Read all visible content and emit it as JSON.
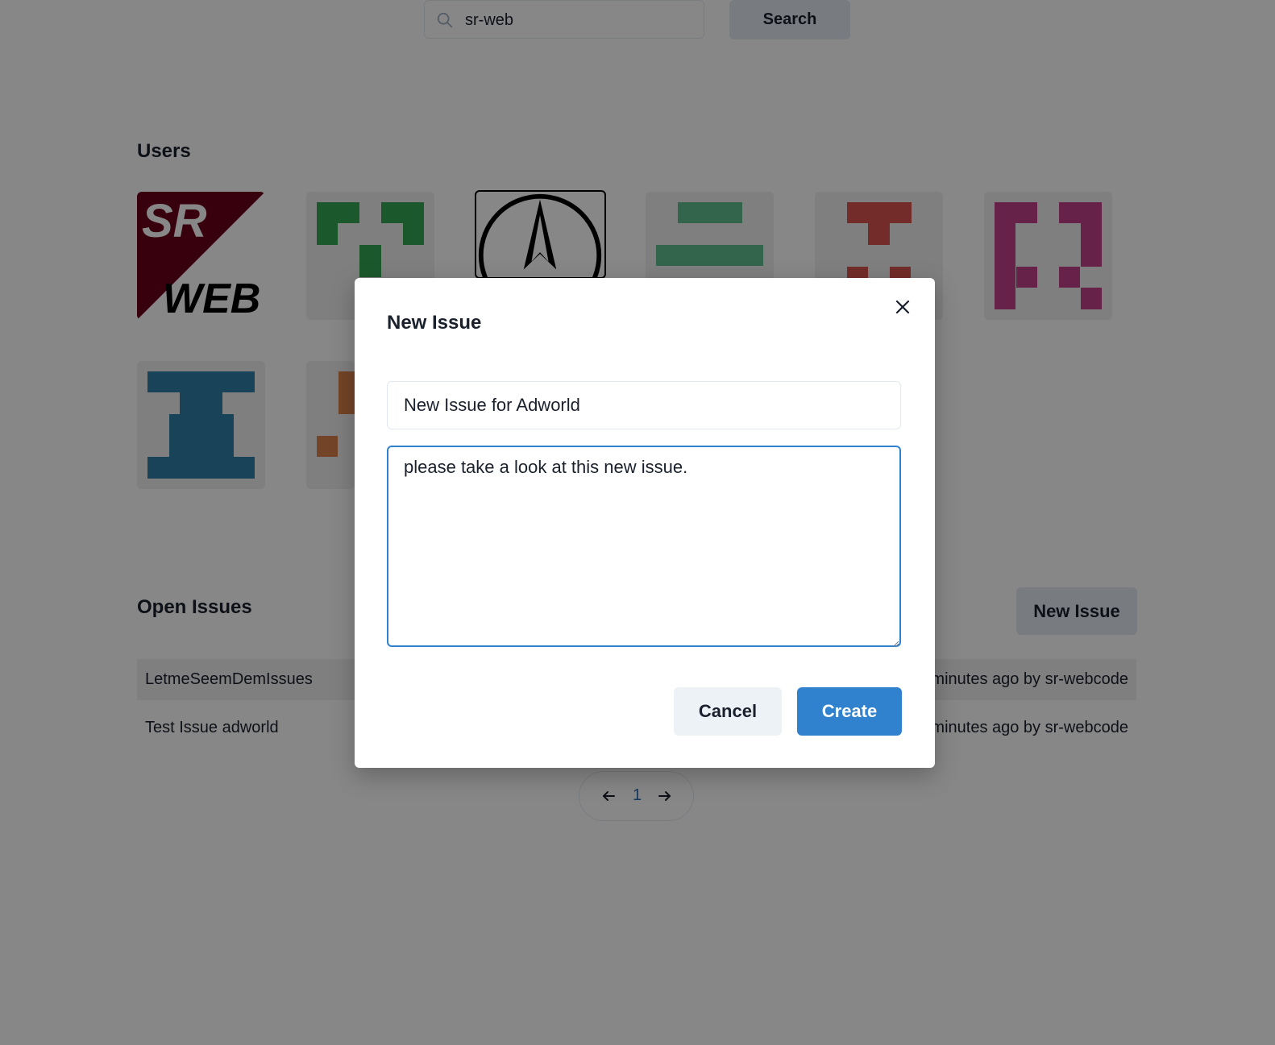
{
  "search": {
    "value": "sr-web",
    "icon": "search-icon",
    "button_label": "Search"
  },
  "users": {
    "title": "Users",
    "avatars": [
      {
        "name": "sr-web-logo",
        "text_top": "SR",
        "text_bottom": "WEB",
        "colors": [
          "#6b0019",
          "#ffffff"
        ]
      },
      {
        "name": "identicon-green",
        "color": "#34a853"
      },
      {
        "name": "circle-a-logo",
        "color": "#000000"
      },
      {
        "name": "identicon-teal",
        "color": "#5fbf8f"
      },
      {
        "name": "identicon-red",
        "color": "#d9534f"
      },
      {
        "name": "identicon-magenta",
        "color": "#c2418a"
      },
      {
        "name": "identicon-blue",
        "color": "#2f7fa6"
      },
      {
        "name": "identicon-orange",
        "color": "#d9804a"
      }
    ]
  },
  "issues": {
    "title": "Open Issues",
    "new_button_label": "New Issue",
    "rows": [
      {
        "title": "LetmeSeemDemIssues",
        "meta": "minutes ago by sr-webcode"
      },
      {
        "title": "Test Issue adworld",
        "meta": "minutes ago by sr-webcode"
      }
    ]
  },
  "pagination": {
    "current_page": "1",
    "prev_icon": "arrow-left-icon",
    "next_icon": "arrow-right-icon"
  },
  "modal": {
    "title": "New Issue",
    "close_icon": "close-icon",
    "title_value": "New Issue for Adworld",
    "body_value": "please take a look at this new issue.",
    "cancel_label": "Cancel",
    "create_label": "Create"
  },
  "colors": {
    "accent": "#3182ce",
    "overlay": "rgba(0,0,0,0.47)",
    "button_gray": "#e2e8f0",
    "page_link": "#2b6cb0"
  }
}
